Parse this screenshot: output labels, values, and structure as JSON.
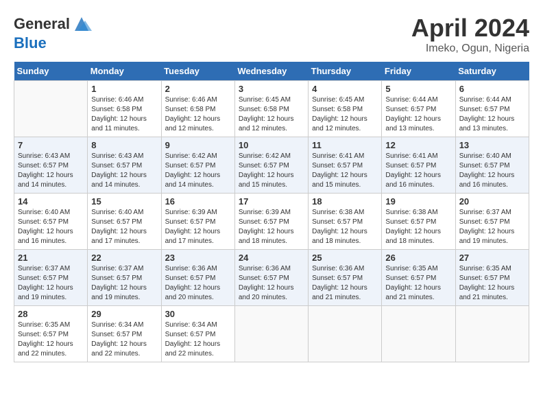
{
  "header": {
    "logo_general": "General",
    "logo_blue": "Blue",
    "month_title": "April 2024",
    "location": "Imeko, Ogun, Nigeria"
  },
  "days_of_week": [
    "Sunday",
    "Monday",
    "Tuesday",
    "Wednesday",
    "Thursday",
    "Friday",
    "Saturday"
  ],
  "weeks": [
    [
      {
        "day": "",
        "info": ""
      },
      {
        "day": "1",
        "info": "Sunrise: 6:46 AM\nSunset: 6:58 PM\nDaylight: 12 hours\nand 11 minutes."
      },
      {
        "day": "2",
        "info": "Sunrise: 6:46 AM\nSunset: 6:58 PM\nDaylight: 12 hours\nand 12 minutes."
      },
      {
        "day": "3",
        "info": "Sunrise: 6:45 AM\nSunset: 6:58 PM\nDaylight: 12 hours\nand 12 minutes."
      },
      {
        "day": "4",
        "info": "Sunrise: 6:45 AM\nSunset: 6:58 PM\nDaylight: 12 hours\nand 12 minutes."
      },
      {
        "day": "5",
        "info": "Sunrise: 6:44 AM\nSunset: 6:57 PM\nDaylight: 12 hours\nand 13 minutes."
      },
      {
        "day": "6",
        "info": "Sunrise: 6:44 AM\nSunset: 6:57 PM\nDaylight: 12 hours\nand 13 minutes."
      }
    ],
    [
      {
        "day": "7",
        "info": "Sunrise: 6:43 AM\nSunset: 6:57 PM\nDaylight: 12 hours\nand 14 minutes."
      },
      {
        "day": "8",
        "info": "Sunrise: 6:43 AM\nSunset: 6:57 PM\nDaylight: 12 hours\nand 14 minutes."
      },
      {
        "day": "9",
        "info": "Sunrise: 6:42 AM\nSunset: 6:57 PM\nDaylight: 12 hours\nand 14 minutes."
      },
      {
        "day": "10",
        "info": "Sunrise: 6:42 AM\nSunset: 6:57 PM\nDaylight: 12 hours\nand 15 minutes."
      },
      {
        "day": "11",
        "info": "Sunrise: 6:41 AM\nSunset: 6:57 PM\nDaylight: 12 hours\nand 15 minutes."
      },
      {
        "day": "12",
        "info": "Sunrise: 6:41 AM\nSunset: 6:57 PM\nDaylight: 12 hours\nand 16 minutes."
      },
      {
        "day": "13",
        "info": "Sunrise: 6:40 AM\nSunset: 6:57 PM\nDaylight: 12 hours\nand 16 minutes."
      }
    ],
    [
      {
        "day": "14",
        "info": "Sunrise: 6:40 AM\nSunset: 6:57 PM\nDaylight: 12 hours\nand 16 minutes."
      },
      {
        "day": "15",
        "info": "Sunrise: 6:40 AM\nSunset: 6:57 PM\nDaylight: 12 hours\nand 17 minutes."
      },
      {
        "day": "16",
        "info": "Sunrise: 6:39 AM\nSunset: 6:57 PM\nDaylight: 12 hours\nand 17 minutes."
      },
      {
        "day": "17",
        "info": "Sunrise: 6:39 AM\nSunset: 6:57 PM\nDaylight: 12 hours\nand 18 minutes."
      },
      {
        "day": "18",
        "info": "Sunrise: 6:38 AM\nSunset: 6:57 PM\nDaylight: 12 hours\nand 18 minutes."
      },
      {
        "day": "19",
        "info": "Sunrise: 6:38 AM\nSunset: 6:57 PM\nDaylight: 12 hours\nand 18 minutes."
      },
      {
        "day": "20",
        "info": "Sunrise: 6:37 AM\nSunset: 6:57 PM\nDaylight: 12 hours\nand 19 minutes."
      }
    ],
    [
      {
        "day": "21",
        "info": "Sunrise: 6:37 AM\nSunset: 6:57 PM\nDaylight: 12 hours\nand 19 minutes."
      },
      {
        "day": "22",
        "info": "Sunrise: 6:37 AM\nSunset: 6:57 PM\nDaylight: 12 hours\nand 19 minutes."
      },
      {
        "day": "23",
        "info": "Sunrise: 6:36 AM\nSunset: 6:57 PM\nDaylight: 12 hours\nand 20 minutes."
      },
      {
        "day": "24",
        "info": "Sunrise: 6:36 AM\nSunset: 6:57 PM\nDaylight: 12 hours\nand 20 minutes."
      },
      {
        "day": "25",
        "info": "Sunrise: 6:36 AM\nSunset: 6:57 PM\nDaylight: 12 hours\nand 21 minutes."
      },
      {
        "day": "26",
        "info": "Sunrise: 6:35 AM\nSunset: 6:57 PM\nDaylight: 12 hours\nand 21 minutes."
      },
      {
        "day": "27",
        "info": "Sunrise: 6:35 AM\nSunset: 6:57 PM\nDaylight: 12 hours\nand 21 minutes."
      }
    ],
    [
      {
        "day": "28",
        "info": "Sunrise: 6:35 AM\nSunset: 6:57 PM\nDaylight: 12 hours\nand 22 minutes."
      },
      {
        "day": "29",
        "info": "Sunrise: 6:34 AM\nSunset: 6:57 PM\nDaylight: 12 hours\nand 22 minutes."
      },
      {
        "day": "30",
        "info": "Sunrise: 6:34 AM\nSunset: 6:57 PM\nDaylight: 12 hours\nand 22 minutes."
      },
      {
        "day": "",
        "info": ""
      },
      {
        "day": "",
        "info": ""
      },
      {
        "day": "",
        "info": ""
      },
      {
        "day": "",
        "info": ""
      }
    ]
  ]
}
